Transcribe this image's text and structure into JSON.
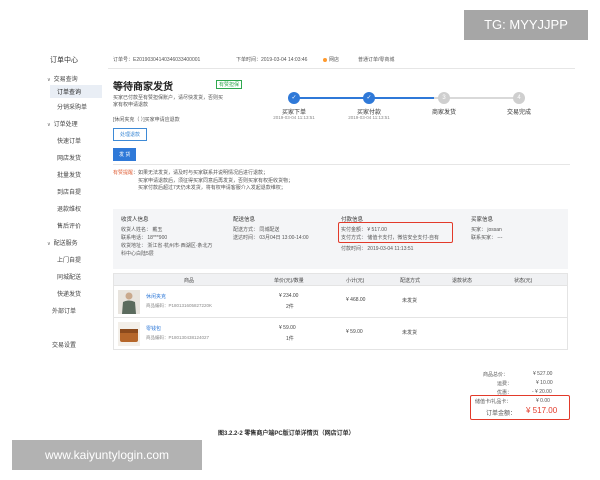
{
  "sidebar": {
    "title": "订单中心",
    "items": [
      {
        "label": "交易查询",
        "type": "group"
      },
      {
        "label": "订单查询",
        "type": "sub",
        "active": true
      },
      {
        "label": "分销采购单",
        "type": "sub"
      },
      {
        "label": "订单处理",
        "type": "group"
      },
      {
        "label": "快速订单",
        "type": "sub"
      },
      {
        "label": "网店发货",
        "type": "sub"
      },
      {
        "label": "批量发货",
        "type": "sub"
      },
      {
        "label": "到店自提",
        "type": "sub"
      },
      {
        "label": "退款维权",
        "type": "sub"
      },
      {
        "label": "售后评价",
        "type": "sub"
      },
      {
        "label": "配送服务",
        "type": "group"
      },
      {
        "label": "上门自提",
        "type": "sub"
      },
      {
        "label": "同城配送",
        "type": "sub"
      },
      {
        "label": "快递发货",
        "type": "sub"
      },
      {
        "label": "外部订单",
        "type": "plain"
      },
      {
        "label": "交易设置",
        "type": "plain"
      }
    ]
  },
  "topbar": {
    "order_no": "订单号：E20190304140346033400001",
    "order_time": "下单时间：2019-03-04 14:03:46",
    "store": "网店",
    "order_type": "普通订单/零商城"
  },
  "status": {
    "title": "等待商家发货",
    "tag": "有赞担保",
    "desc": "买家已付款至有赞担保账户，请尽快发货，否则买家有权申请退款",
    "desc2": "[休闲夹克（ ）]买家申请应退款",
    "btn_outline": "处理退款",
    "btn_primary": "发 货"
  },
  "steps": [
    {
      "label": "买家下单",
      "time": "2019-03-04 11:13:51",
      "done": true,
      "num": "1"
    },
    {
      "label": "买家付款",
      "time": "2019-03-04 11:13:51",
      "done": true,
      "num": "2"
    },
    {
      "label": "商家发货",
      "time": "",
      "done": false,
      "num": "3"
    },
    {
      "label": "交易完成",
      "time": "",
      "done": false,
      "num": "4"
    }
  ],
  "note": {
    "label": "有赞提醒",
    "lines": [
      "如果无法发货，请及时与买家联系并说明情况后进行退款；",
      "买家申请退款后，须征得买家同意后再发货，否则买家有权拒收货物；",
      "买家付款后超过7天仍未发货，将有权申请客服介入发起退款维权；"
    ]
  },
  "info": {
    "receiver_head": "收货人信息",
    "receiver_lines": [
      "收货人姓名：  戴玉",
      "联系电话：  18***900",
      "收货地址：  浙江省·杭州市·西湖区·条北万",
      "科中心白陆5层"
    ],
    "delivery_head": "配送信息",
    "delivery_lines": [
      "配送方式：  同城配送",
      "送达时间：  03月04日 13:00-14:00"
    ],
    "payment_head": "付款信息",
    "payment_lines": [
      "实付金额：  ¥ 517.00",
      "支付方式：  储值卡支付，微信安全支付-自有",
      "付款时间：  2019-03-04 11:13:51"
    ],
    "buyer_head": "买家信息",
    "buyer_lines": [
      "买家：  jossan",
      "联系买家：  ---"
    ]
  },
  "table": {
    "headers": [
      "商品",
      "单价(元)/数量",
      "小计(元)",
      "配送方式",
      "退款状态",
      "状态(元)"
    ],
    "rows": [
      {
        "name": "休闲夹克",
        "code": "商品编码：P180131605827220K",
        "price": "¥ 234.00",
        "qty": "2件",
        "subtotal": "¥ 468.00",
        "delivery": "未发货"
      },
      {
        "name": "零钱包",
        "code": "商品编码：P180130438124027",
        "price": "¥ 59.00",
        "qty": "1件",
        "subtotal": "¥ 59.00",
        "delivery": "未发货"
      }
    ]
  },
  "summary": {
    "goods_total_label": "商品总价：",
    "goods_total": "¥ 527.00",
    "shipping_label": "运费：",
    "shipping": "¥ 10.00",
    "discount_label": "优惠：",
    "discount": "- ¥ 20.00",
    "card_label": "储值卡/礼品卡：",
    "card": "¥ 0.00",
    "order_total_label": "订单金额：",
    "order_total": "¥ 517.00"
  },
  "caption": "图3.2.2-2 零售商户端PC版订单详情页（网店订单）",
  "watermark_top": "TG: MYYJJPP",
  "watermark_bottom": "www.kaiyuntylogin.com",
  "colors": {
    "accent": "#2f79d8",
    "highlight": "#e23a2a",
    "green": "#2fa84f"
  }
}
